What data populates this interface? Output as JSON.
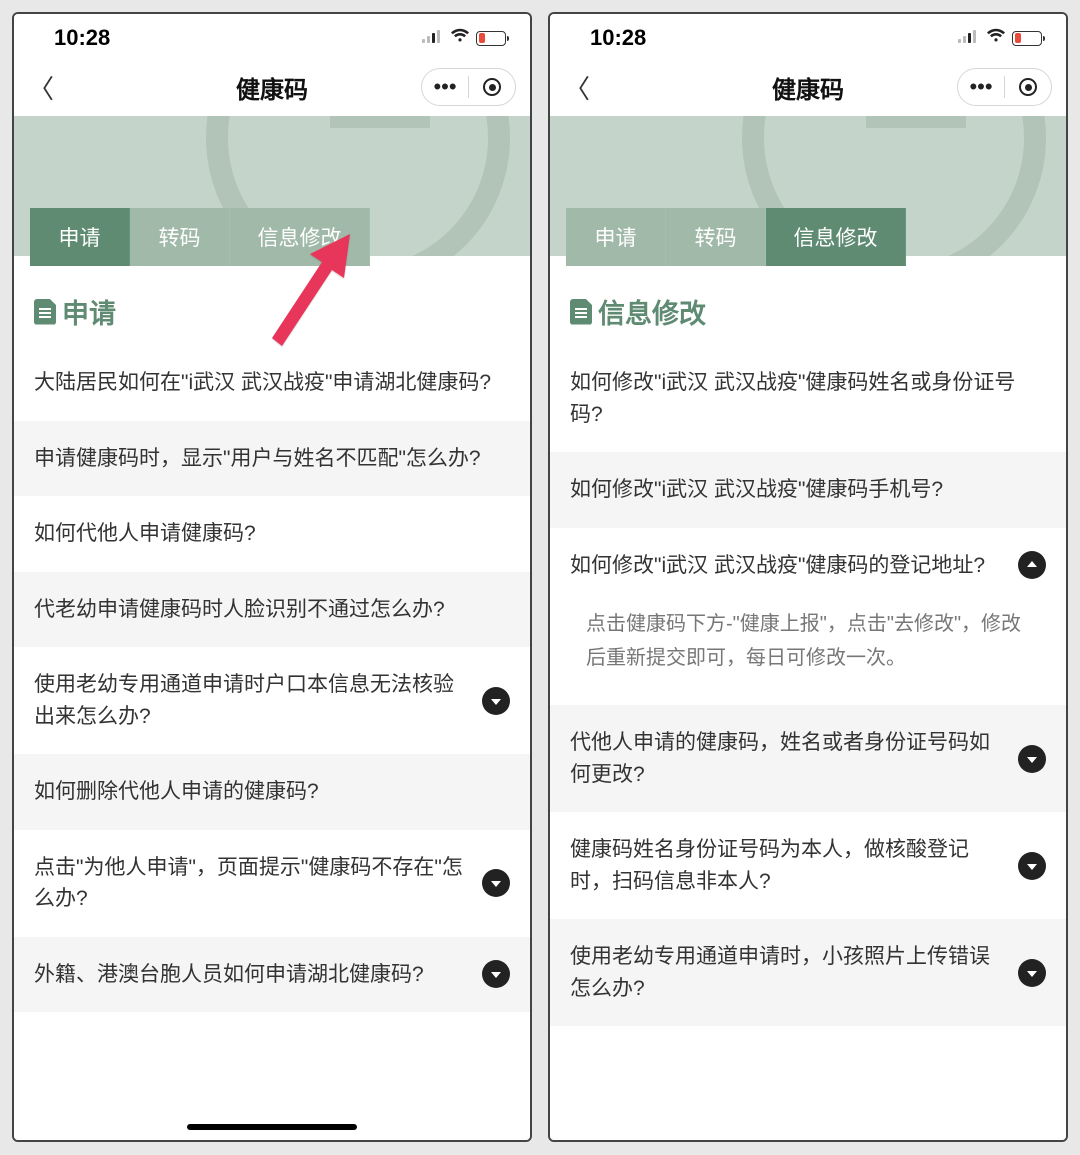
{
  "status": {
    "time": "10:28"
  },
  "nav": {
    "title": "健康码"
  },
  "tabs": [
    {
      "label": "申请"
    },
    {
      "label": "转码"
    },
    {
      "label": "信息修改"
    }
  ],
  "left": {
    "active_tab_index": 0,
    "section_title": "申请",
    "items": [
      {
        "q": "大陆居民如何在\"i武汉 武汉战疫\"申请湖北健康码?",
        "has_toggle": false
      },
      {
        "q": "申请健康码时，显示\"用户与姓名不匹配\"怎么办?",
        "has_toggle": false
      },
      {
        "q": "如何代他人申请健康码?",
        "has_toggle": false
      },
      {
        "q": "代老幼申请健康码时人脸识别不通过怎么办?",
        "has_toggle": false
      },
      {
        "q": "使用老幼专用通道申请时户口本信息无法核验出来怎么办?",
        "has_toggle": true
      },
      {
        "q": "如何删除代他人申请的健康码?",
        "has_toggle": false
      },
      {
        "q": "点击\"为他人申请\"，页面提示\"健康码不存在\"怎么办?",
        "has_toggle": true
      },
      {
        "q": "外籍、港澳台胞人员如何申请湖北健康码?",
        "has_toggle": true
      }
    ]
  },
  "right": {
    "active_tab_index": 2,
    "section_title": "信息修改",
    "items": [
      {
        "q": "如何修改\"i武汉 武汉战疫\"健康码姓名或身份证号码?",
        "has_toggle": false,
        "expanded": false
      },
      {
        "q": "如何修改\"i武汉 武汉战疫\"健康码手机号?",
        "has_toggle": false,
        "expanded": false
      },
      {
        "q": "如何修改\"i武汉 武汉战疫\"健康码的登记地址?",
        "has_toggle": true,
        "expanded": true,
        "answer": "点击健康码下方-\"健康上报\"，点击\"去修改\"，修改后重新提交即可，每日可修改一次。"
      },
      {
        "q": "代他人申请的健康码，姓名或者身份证号码如何更改?",
        "has_toggle": true,
        "expanded": false
      },
      {
        "q": "健康码姓名身份证号码为本人，做核酸登记时，扫码信息非本人?",
        "has_toggle": true,
        "expanded": false
      },
      {
        "q": "使用老幼专用通道申请时，小孩照片上传错误怎么办?",
        "has_toggle": true,
        "expanded": false
      }
    ]
  }
}
